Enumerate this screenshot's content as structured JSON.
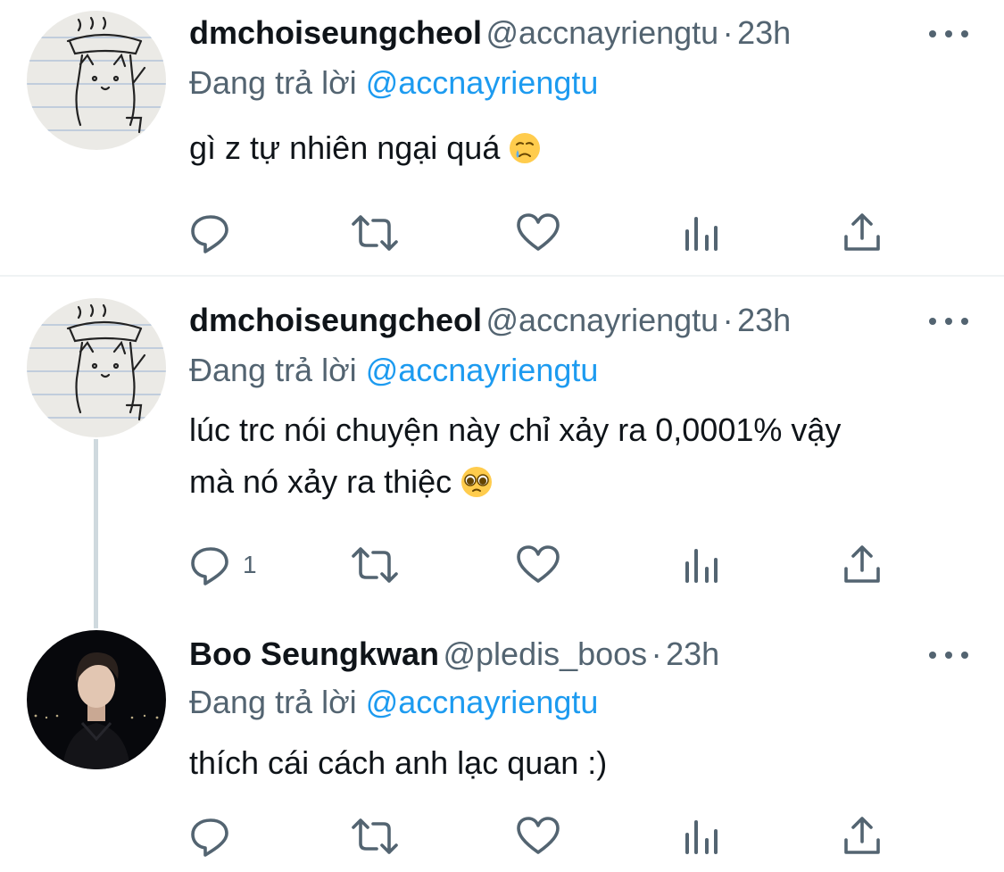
{
  "tweets": [
    {
      "name": "dmchoiseungcheol",
      "handle": "@accnayriengtu",
      "separator": "·",
      "time": "23h",
      "reply_prefix": "Đang trả lời",
      "reply_to": "@accnayriengtu",
      "lines": [
        "gì z tự nhiên ngại quá"
      ],
      "emoji": "sad-relieved-face",
      "reply_count": "",
      "avatar": "cat-sketch"
    },
    {
      "name": "dmchoiseungcheol",
      "handle": "@accnayriengtu",
      "separator": "·",
      "time": "23h",
      "reply_prefix": "Đang trả lời",
      "reply_to": "@accnayriengtu",
      "lines": [
        "lúc trc nói chuyện này chỉ xảy ra 0,0001% vậy",
        "mà nó xảy ra thiệc"
      ],
      "emoji": "pleading-face",
      "reply_count": "1",
      "avatar": "cat-sketch"
    },
    {
      "name": "Boo Seungkwan",
      "handle": "@pledis_boos",
      "separator": "·",
      "time": "23h",
      "reply_prefix": "Đang trả lời",
      "reply_to": "@accnayriengtu",
      "lines": [
        "thích cái cách anh lạc quan :)"
      ],
      "emoji": "",
      "reply_count": "",
      "avatar": "person-night-photo"
    }
  ],
  "icons": {
    "reply": "reply-icon",
    "retweet": "retweet-icon",
    "like": "like-icon",
    "views": "views-icon",
    "share": "share-icon",
    "more": "more-icon"
  },
  "colors": {
    "text": "#0f1419",
    "secondary": "#536471",
    "accent": "#1d9bf0",
    "divider": "#eff3f4",
    "thread_line": "#cfd9de"
  }
}
